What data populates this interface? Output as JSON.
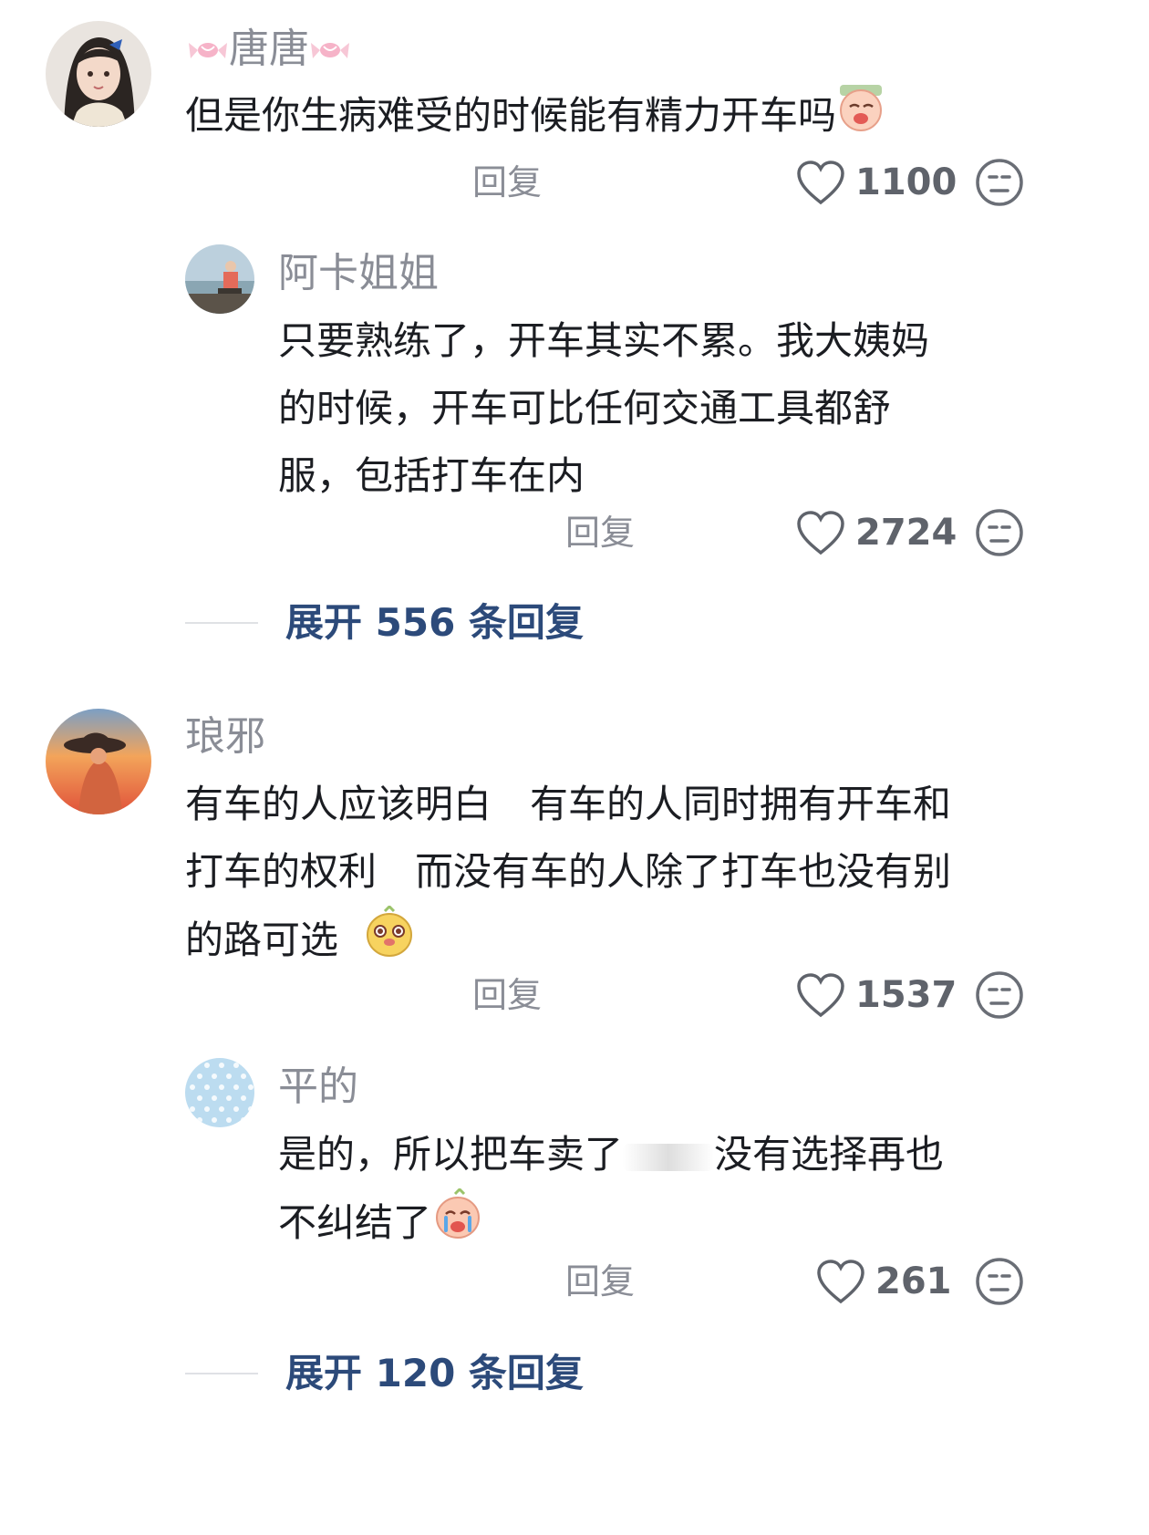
{
  "comments": [
    {
      "user": {
        "name": "唐唐",
        "avatar": "avatar-girl-blue-bow"
      },
      "content": "但是你生病难受的时候能有精力开车吗",
      "emoji": "crying-emoji",
      "reply_label": "回复",
      "likes": "1100",
      "replies": [
        {
          "user": {
            "name": "阿卡姐姐",
            "avatar": "avatar-person-lakeside"
          },
          "content": "只要熟练了，开车其实不累。我大姨妈的时候，开车可比任何交通工具都舒服，包括打车在内",
          "reply_label": "回复",
          "likes": "2724"
        }
      ],
      "expand_label": "展开 556 条回复"
    },
    {
      "user": {
        "name": "琅邪",
        "avatar": "avatar-hat-sunset"
      },
      "content": "有车的人应该明白　有车的人同时拥有开车和打车的权利　而没有车的人除了打车也没有别的路可选",
      "emoji": "meerkat-emoji",
      "reply_label": "回复",
      "likes": "1537",
      "replies": [
        {
          "user": {
            "name": "平的",
            "avatar": "avatar-blue-dots"
          },
          "content_before": "是的，所以把车卖了",
          "content_after": "没有选择再也不纠结了",
          "emoji": "tears-emoji",
          "reply_label": "回复",
          "likes": "261"
        }
      ],
      "expand_label": "展开 120 条回复"
    }
  ]
}
